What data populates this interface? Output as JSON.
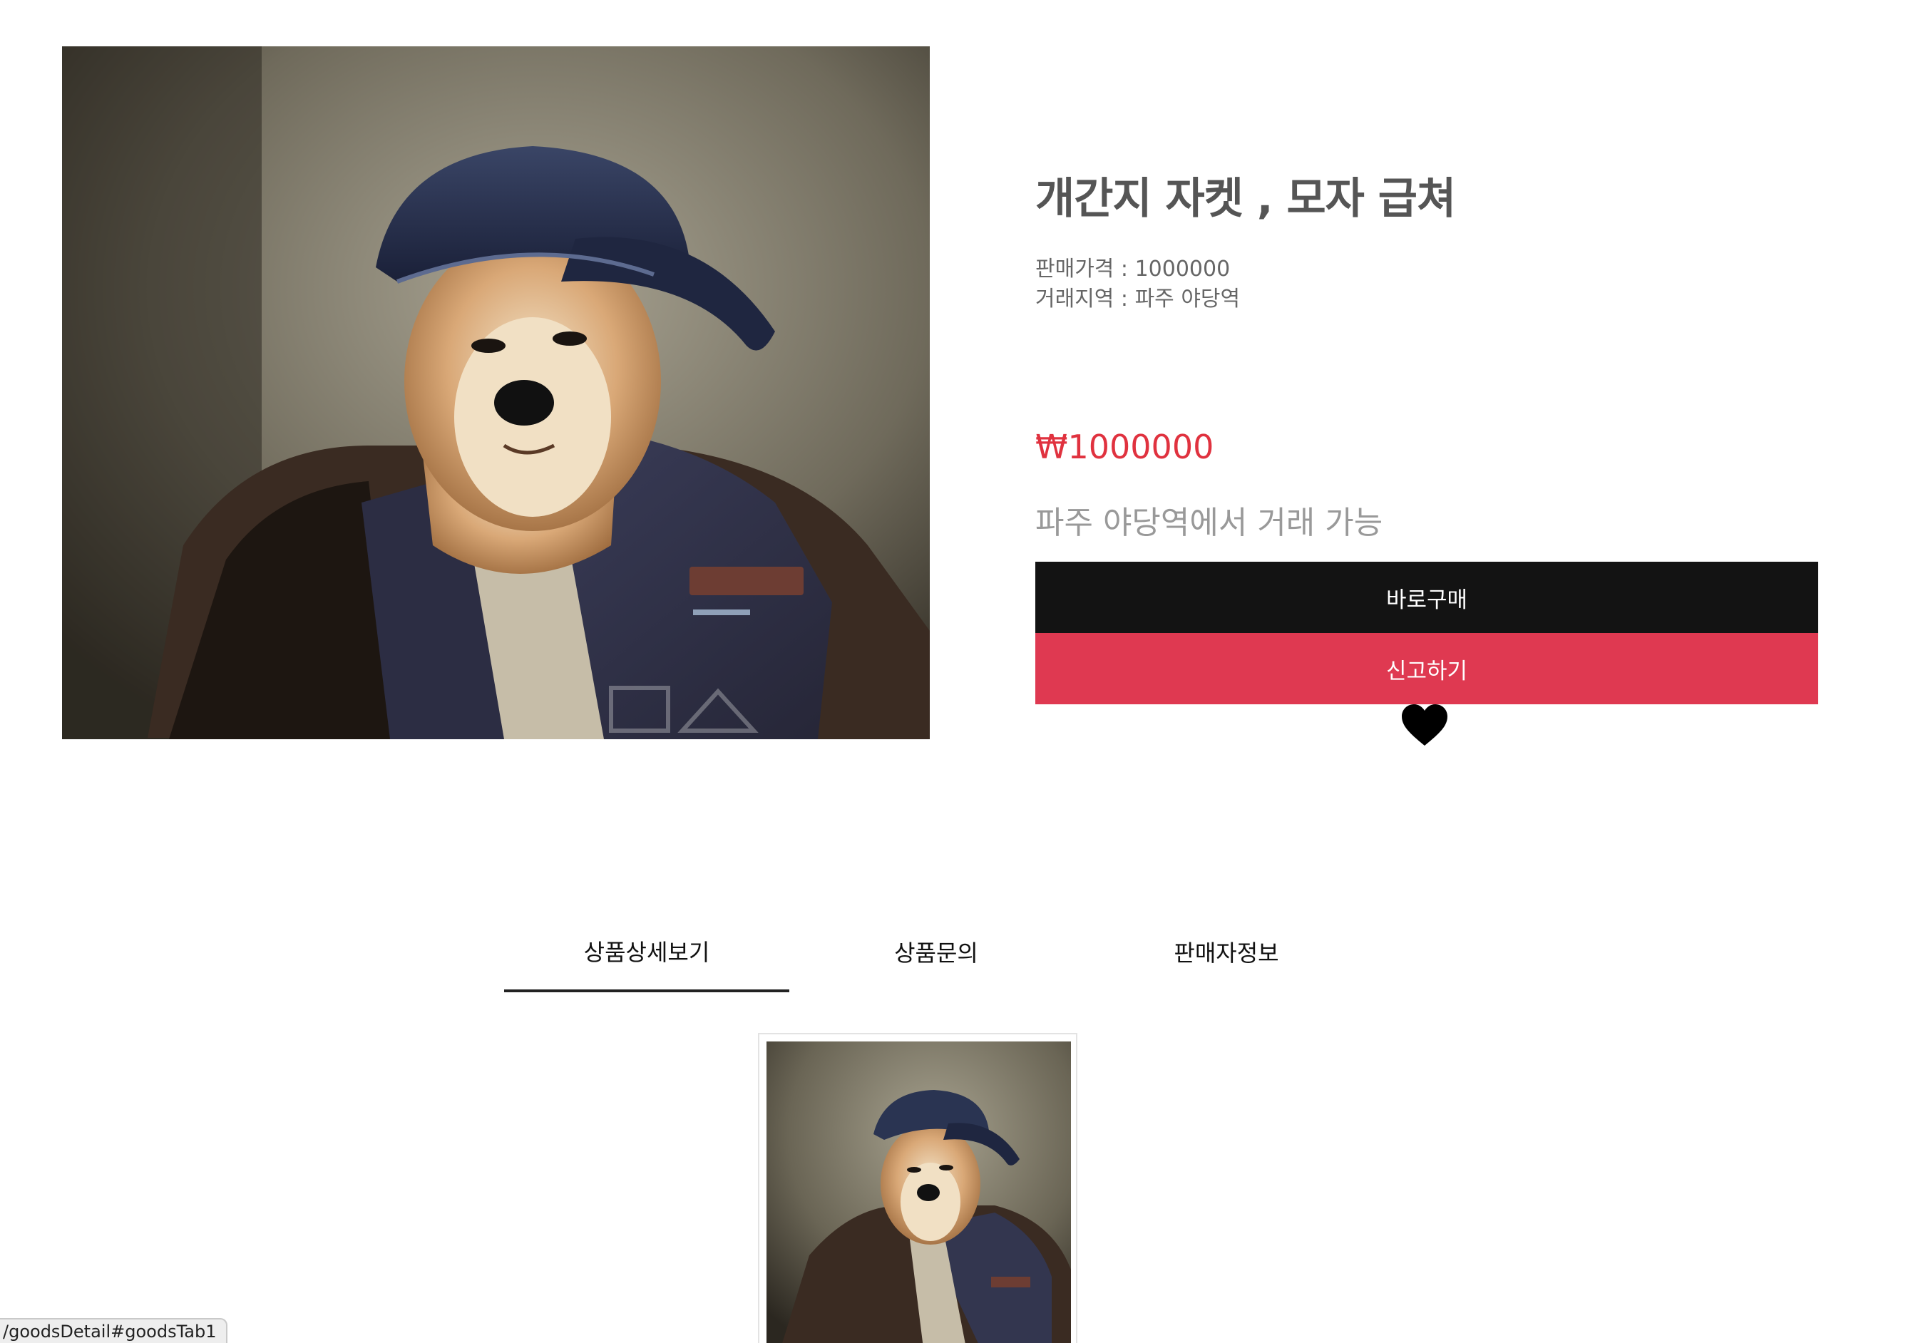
{
  "product": {
    "image_alt": "dog-in-cap-and-jacket-photo",
    "title": "개간지 자켓 , 모자 급쳐",
    "sale_price_line": "판매가격 : 1000000",
    "trade_area_line": "거래지역 : 파주 야당역",
    "price_display": "₩1000000",
    "trade_note": "파주 야당역에서 거래 가능"
  },
  "actions": {
    "buy_label": "바로구매",
    "report_label": "신고하기",
    "like_icon": "heart-icon"
  },
  "tabs": [
    {
      "label": "상품상세보기",
      "active": true
    },
    {
      "label": "상품문의",
      "active": false
    },
    {
      "label": "판매자정보",
      "active": false
    }
  ],
  "statusbar": {
    "url": "/goodsDetail#goodsTab1"
  },
  "colors": {
    "price_red": "#e0323f",
    "buy_button": "#131313",
    "report_button": "#df3951"
  }
}
